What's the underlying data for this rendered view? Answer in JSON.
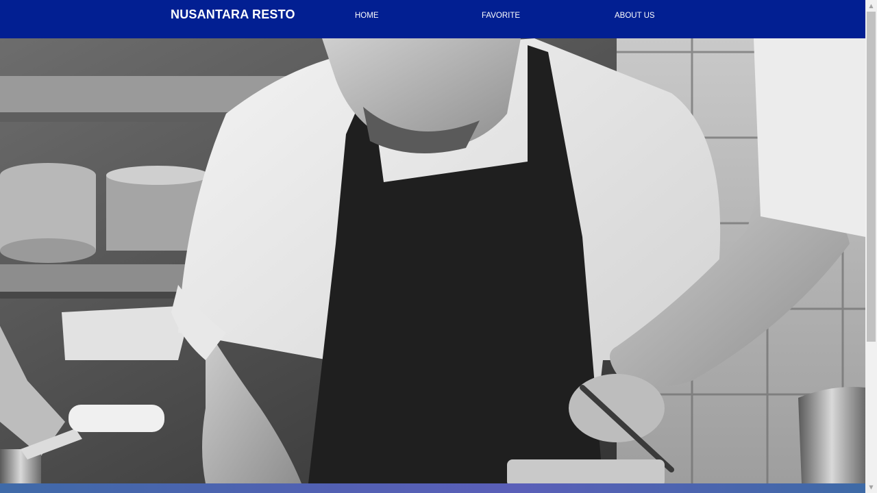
{
  "navbar": {
    "brand": "NUSANTARA RESTO",
    "links": [
      {
        "label": "HOME"
      },
      {
        "label": "FAVORITE"
      },
      {
        "label": "ABOUT US"
      }
    ],
    "background_color": "#021f92"
  },
  "hero": {
    "image_description_icon": "chef-photo-icon"
  },
  "scrollbar": {
    "up_icon": "scroll-up-arrow-icon",
    "down_icon": "scroll-down-arrow-icon"
  }
}
